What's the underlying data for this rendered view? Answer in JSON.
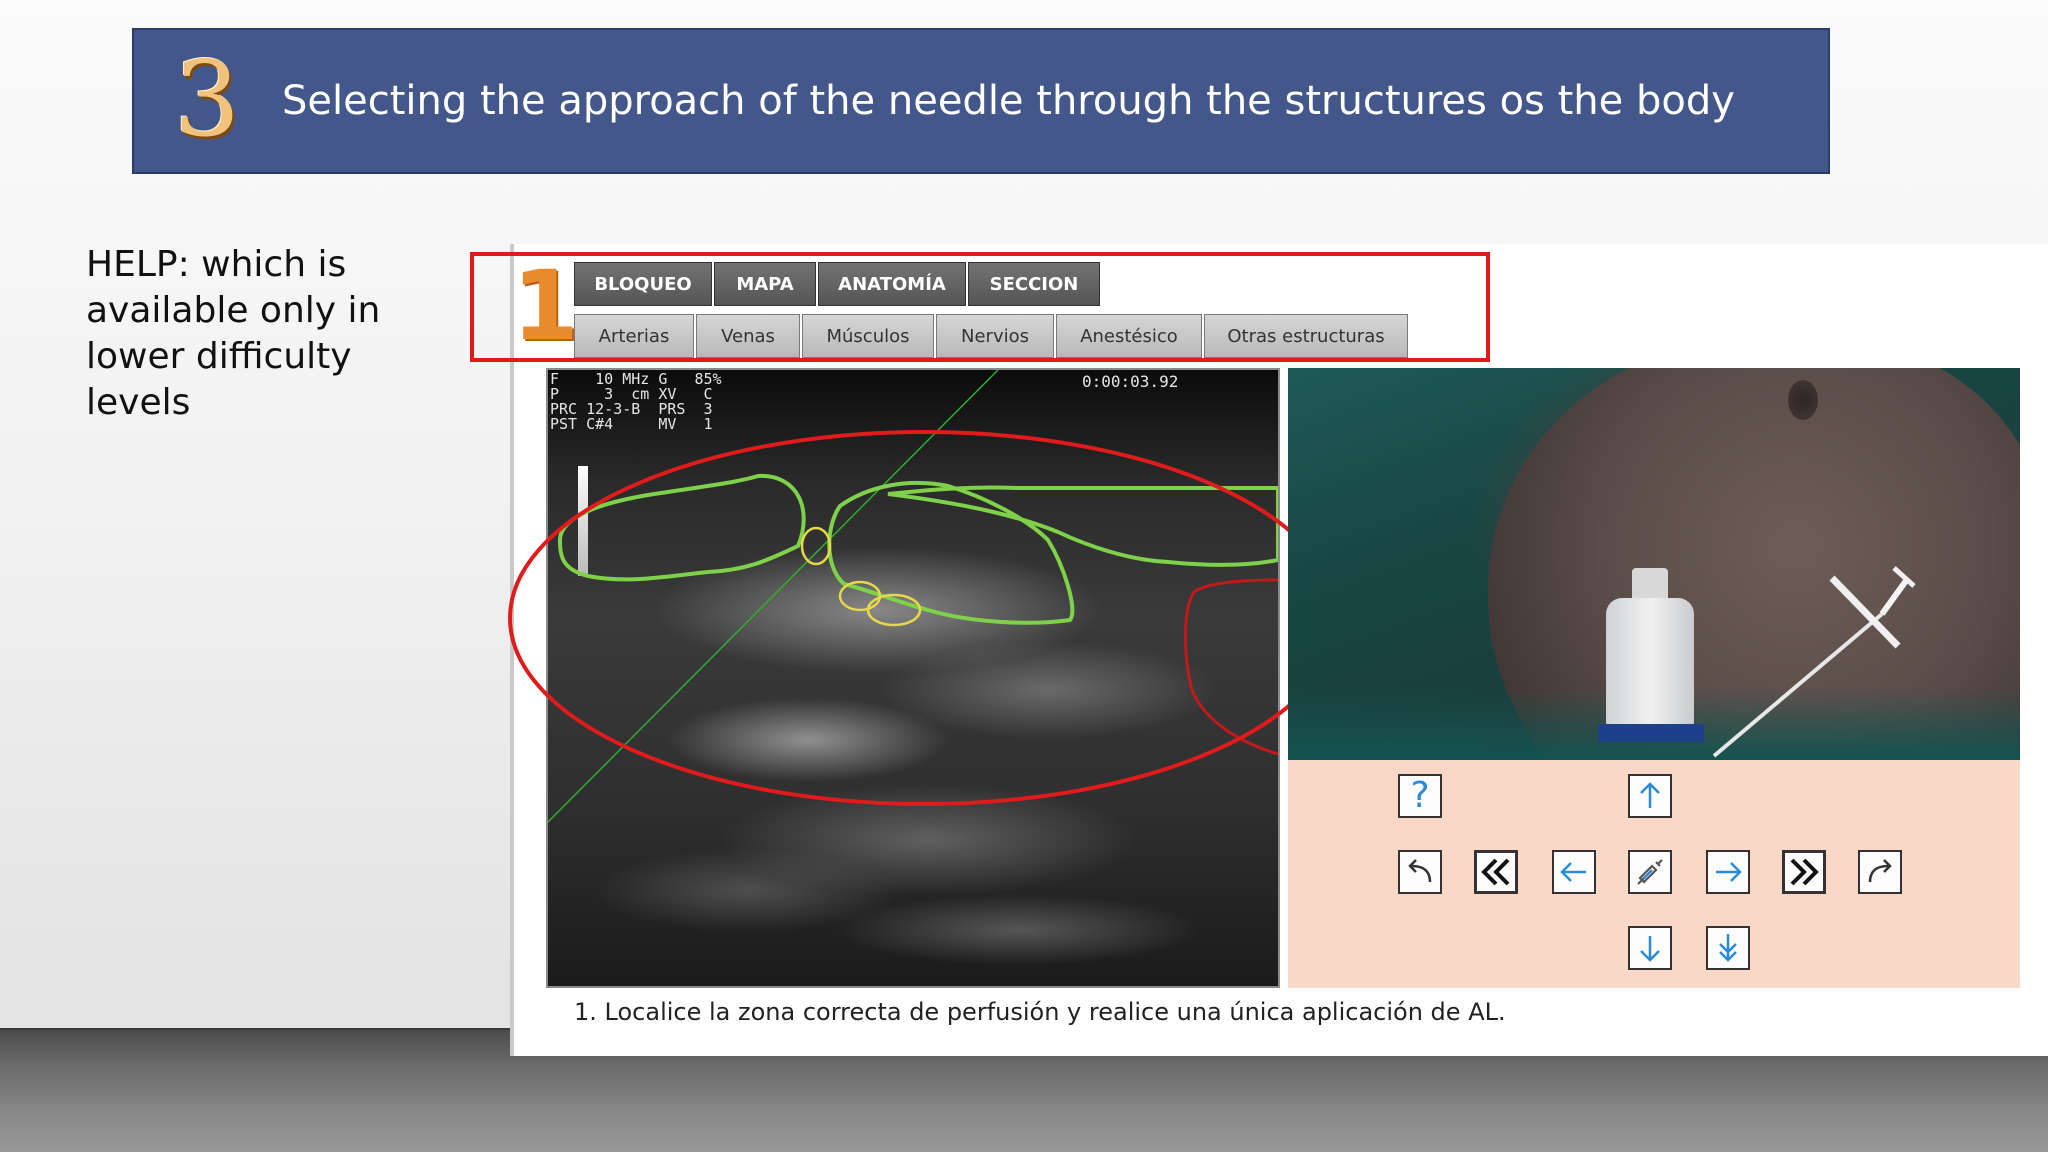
{
  "slide": {
    "number": "3",
    "title": "Selecting the approach of the needle through the structures os the body",
    "help_note": "HELP: which is available only in lower difficulty levels"
  },
  "app": {
    "step_indicator": "1",
    "primary_tabs": [
      "BLOQUEO",
      "MAPA",
      "ANATOMÍA",
      "SECCION"
    ],
    "secondary_tabs": [
      "Arterias",
      "Venas",
      "Músculos",
      "Nervios",
      "Anestésico",
      "Otras estructuras"
    ],
    "ultrasound": {
      "params": [
        "F    10 MHz G   85%",
        "P     3  cm XV   C",
        "PRC 12-3-B  PRS  3",
        "PST C#4     MV   1"
      ],
      "time": "0:00:03.92"
    },
    "controls": {
      "help_symbol": "?",
      "icons": [
        "help-icon",
        "up-arrow-icon",
        "undo-icon",
        "fast-back-icon",
        "left-arrow-icon",
        "syringe-icon",
        "right-arrow-icon",
        "fast-forward-icon",
        "redo-icon",
        "down-arrow-icon",
        "double-down-arrow-icon"
      ]
    },
    "instruction": "1. Localice la zona correcta de perfusión y realice una única aplicación de AL."
  },
  "colors": {
    "banner": "#44578a",
    "help_highlight": "#e01b1b",
    "muscle_outline": "#7fd14a",
    "nerve_outline": "#e6d84a",
    "artery_outline": "#c21a1a",
    "control_panel": "#f9d8c8",
    "icon_blue": "#2a8bd6"
  }
}
